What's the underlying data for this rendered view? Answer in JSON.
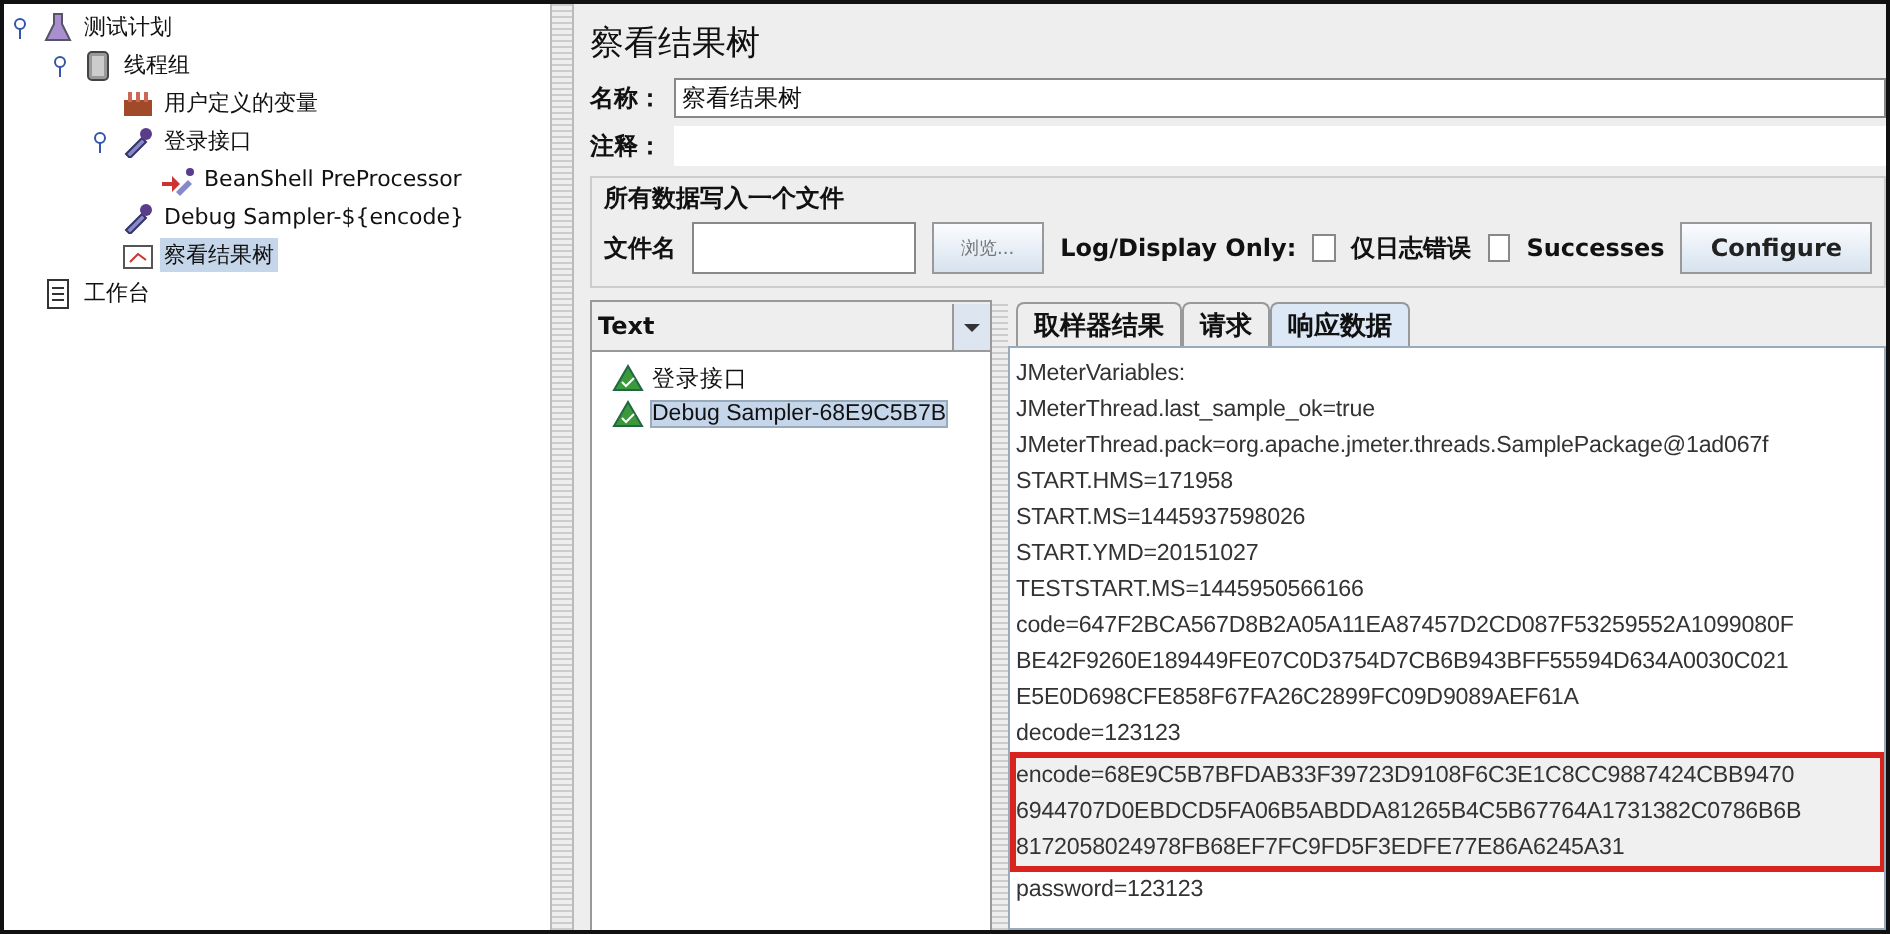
{
  "test_plan_tree": [
    {
      "label": "测试计划",
      "kind": "flask",
      "expanded": true,
      "selected": false,
      "children": [
        {
          "label": "线程组",
          "kind": "spool",
          "expanded": true,
          "selected": false,
          "children": [
            {
              "label": "用户定义的变量",
              "kind": "config",
              "selected": false
            },
            {
              "label": "登录接口",
              "kind": "pipette",
              "expanded": true,
              "selected": false,
              "children": [
                {
                  "label": "BeanShell PreProcessor",
                  "kind": "preprocessor",
                  "selected": false
                }
              ]
            },
            {
              "label": "Debug Sampler-${encode}",
              "kind": "pipette",
              "selected": false
            },
            {
              "label": "察看结果树",
              "kind": "listener",
              "selected": true
            }
          ]
        }
      ]
    },
    {
      "label": "工作台",
      "kind": "workbench",
      "selected": false
    }
  ],
  "panel": {
    "title": "察看结果树",
    "name_label": "名称：",
    "name_value": "察看结果树",
    "comment_label": "注释：",
    "file_group": {
      "legend": "所有数据写入一个文件",
      "file_label": "文件名",
      "browse_button": "浏览...",
      "log_label": "Log/Display Only:",
      "checkboxes": [
        {
          "label": "仅日志错误",
          "checked": false
        },
        {
          "label": "Successes",
          "checked": false
        }
      ],
      "configure_button": "Configure"
    }
  },
  "results": {
    "renderer": "Text",
    "samples": [
      {
        "label": "登录接口",
        "selected": false
      },
      {
        "label": "Debug Sampler-68E9C5B7B",
        "selected": true
      }
    ],
    "tabs": [
      {
        "label": "取样器结果",
        "selected": false
      },
      {
        "label": "请求",
        "selected": false
      },
      {
        "label": "响应数据",
        "selected": true
      }
    ],
    "response_lines": [
      {
        "text": "JMeterVariables:",
        "highlighted": false
      },
      {
        "text": "JMeterThread.last_sample_ok=true",
        "highlighted": false
      },
      {
        "text": "JMeterThread.pack=org.apache.jmeter.threads.SamplePackage@1ad067f",
        "highlighted": false
      },
      {
        "text": "START.HMS=171958",
        "highlighted": false
      },
      {
        "text": "START.MS=1445937598026",
        "highlighted": false
      },
      {
        "text": "START.YMD=20151027",
        "highlighted": false
      },
      {
        "text": "TESTSTART.MS=1445950566166",
        "highlighted": false
      },
      {
        "text": "code=647F2BCA567D8B2A05A11EA87457D2CD087F53259552A1099080F",
        "highlighted": false
      },
      {
        "text": "BE42F9260E189449FE07C0D3754D7CB6B943BFF55594D634A0030C021",
        "highlighted": false
      },
      {
        "text": "E5E0D698CFE858F67FA26C2899FC09D9089AEF61A",
        "highlighted": false
      },
      {
        "text": "decode=123123",
        "highlighted": false
      },
      {
        "text": "encode=68E9C5B7BFDAB33F39723D9108F6C3E1C8CC9887424CBB9470",
        "highlighted": true
      },
      {
        "text": "6944707D0EBDCD5FA06B5ABDDA81265B4C5B67764A1731382C0786B6B",
        "highlighted": true
      },
      {
        "text": "8172058024978FB68EF7FC9FD5F3EDFE77E86A6245A31",
        "highlighted": true
      },
      {
        "text": "password=123123",
        "highlighted": false
      }
    ]
  }
}
